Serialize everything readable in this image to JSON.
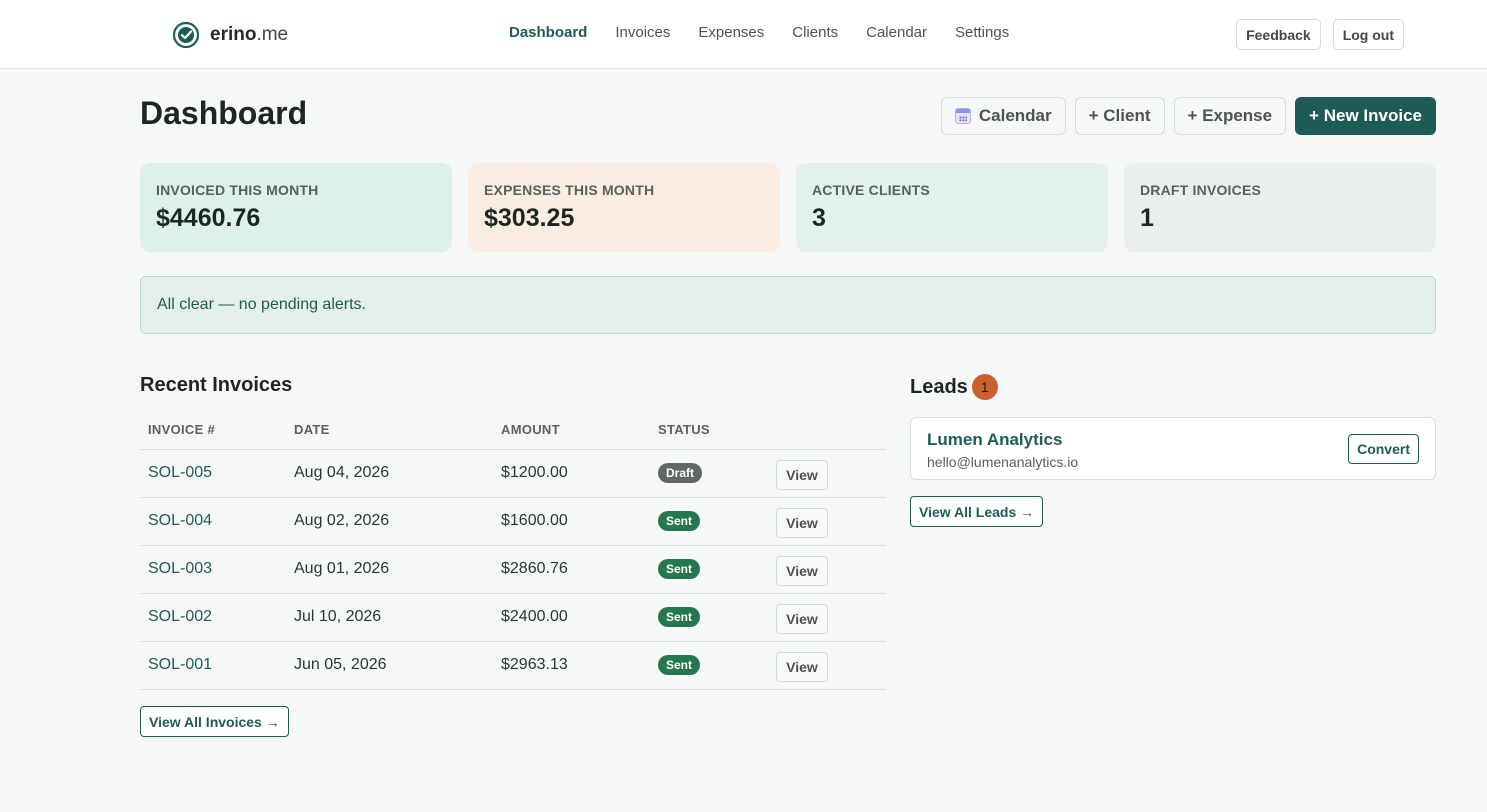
{
  "brand": {
    "name": "erino",
    "tld": ".me",
    "icon": "check-badge-icon"
  },
  "nav": {
    "items": [
      {
        "label": "Dashboard",
        "active": true
      },
      {
        "label": "Invoices"
      },
      {
        "label": "Expenses"
      },
      {
        "label": "Clients"
      },
      {
        "label": "Calendar"
      },
      {
        "label": "Settings"
      }
    ]
  },
  "top_actions": {
    "feedback": "Feedback",
    "logout": "Log out"
  },
  "page": {
    "title": "Dashboard"
  },
  "actions": {
    "calendar": "Calendar",
    "calendar_icon": "calendar-icon",
    "client": "+ Client",
    "expense": "+ Expense",
    "new_invoice": "+ New Invoice"
  },
  "stats": [
    {
      "label": "INVOICED THIS MONTH",
      "value": "$4460.76",
      "bg": "#def0ec"
    },
    {
      "label": "EXPENSES THIS MONTH",
      "value": "$303.25",
      "bg": "#fbece2"
    },
    {
      "label": "ACTIVE CLIENTS",
      "value": "3",
      "bg": "#e2f1ea"
    },
    {
      "label": "DRAFT INVOICES",
      "value": "1",
      "bg": "#eaefed"
    }
  ],
  "alert": {
    "text": "All clear — no pending alerts."
  },
  "recent_invoices": {
    "title": "Recent Invoices",
    "columns": [
      "INVOICE #",
      "DATE",
      "AMOUNT",
      "STATUS",
      ""
    ],
    "rows": [
      {
        "number": "SOL-005",
        "date": "Aug 04, 2026",
        "amount": "$1200.00",
        "status": "Draft",
        "action": "View"
      },
      {
        "number": "SOL-004",
        "date": "Aug 02, 2026",
        "amount": "$1600.00",
        "status": "Sent",
        "action": "View"
      },
      {
        "number": "SOL-003",
        "date": "Aug 01, 2026",
        "amount": "$2860.76",
        "status": "Sent",
        "action": "View"
      },
      {
        "number": "SOL-002",
        "date": "Jul 10, 2026",
        "amount": "$2400.00",
        "status": "Sent",
        "action": "View"
      },
      {
        "number": "SOL-001",
        "date": "Jun 05, 2026",
        "amount": "$2963.13",
        "status": "Sent",
        "action": "View"
      }
    ],
    "view_all": "View All Invoices →"
  },
  "leads": {
    "title": "Leads",
    "count": "1",
    "items": [
      {
        "name": "Lumen Analytics",
        "email": "hello@lumenanalytics.io",
        "action": "Convert"
      }
    ],
    "view_all": "View All Leads →"
  },
  "colors": {
    "accent": "#1d5c56",
    "sent": "#23784f",
    "draft": "#5f6866",
    "lead_badge": "#c8612e"
  }
}
